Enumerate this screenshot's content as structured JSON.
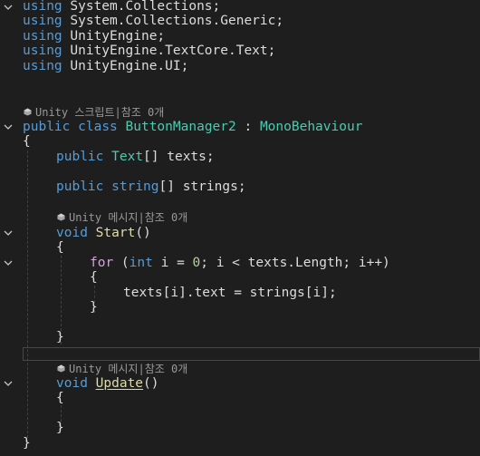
{
  "editor": {
    "language": "C#",
    "theme_colors": {
      "background": "#1e1e1e",
      "keyword": "#569cd6",
      "type": "#4ec9b0",
      "method": "#dcdcaa",
      "number": "#b5cea8",
      "control": "#d8a0df",
      "text": "#dcdcdc",
      "codelens": "#999999"
    },
    "usings": [
      {
        "kw": "using",
        "ns": "System.Collections;"
      },
      {
        "kw": "using",
        "ns": "System.Collections.Generic;"
      },
      {
        "kw": "using",
        "ns": "UnityEngine;"
      },
      {
        "kw": "using",
        "ns": "UnityEngine.TextCore.Text;"
      },
      {
        "kw": "using",
        "ns": "UnityEngine.UI;"
      }
    ],
    "codelens": {
      "class": "Unity 스크립트|참조 0개",
      "start": "Unity 메시지|참조 0개",
      "update": "Unity 메시지|참조 0개",
      "icon": "unity-cube-icon"
    },
    "class_decl": {
      "public": "public",
      "class": "class",
      "name": "ButtonManager2",
      "colon": " : ",
      "base": "MonoBehaviour"
    },
    "field_texts": {
      "public": "public",
      "type": "Text",
      "rest": "[] texts;"
    },
    "field_strings": {
      "public": "public",
      "type": "string",
      "rest": "[] strings;"
    },
    "start_method": {
      "void": "void",
      "name": "Start",
      "parens": "()"
    },
    "for_loop": {
      "for": "for",
      "open": " (",
      "int": "int",
      "init": " i = ",
      "zero": "0",
      "cond": "; i < texts.Length; i++)"
    },
    "assignment": "texts[i].text = strings[i];",
    "update_method": {
      "void": "void",
      "name": "Update",
      "parens": "()"
    },
    "braces": {
      "open": "{",
      "close": "}"
    }
  }
}
